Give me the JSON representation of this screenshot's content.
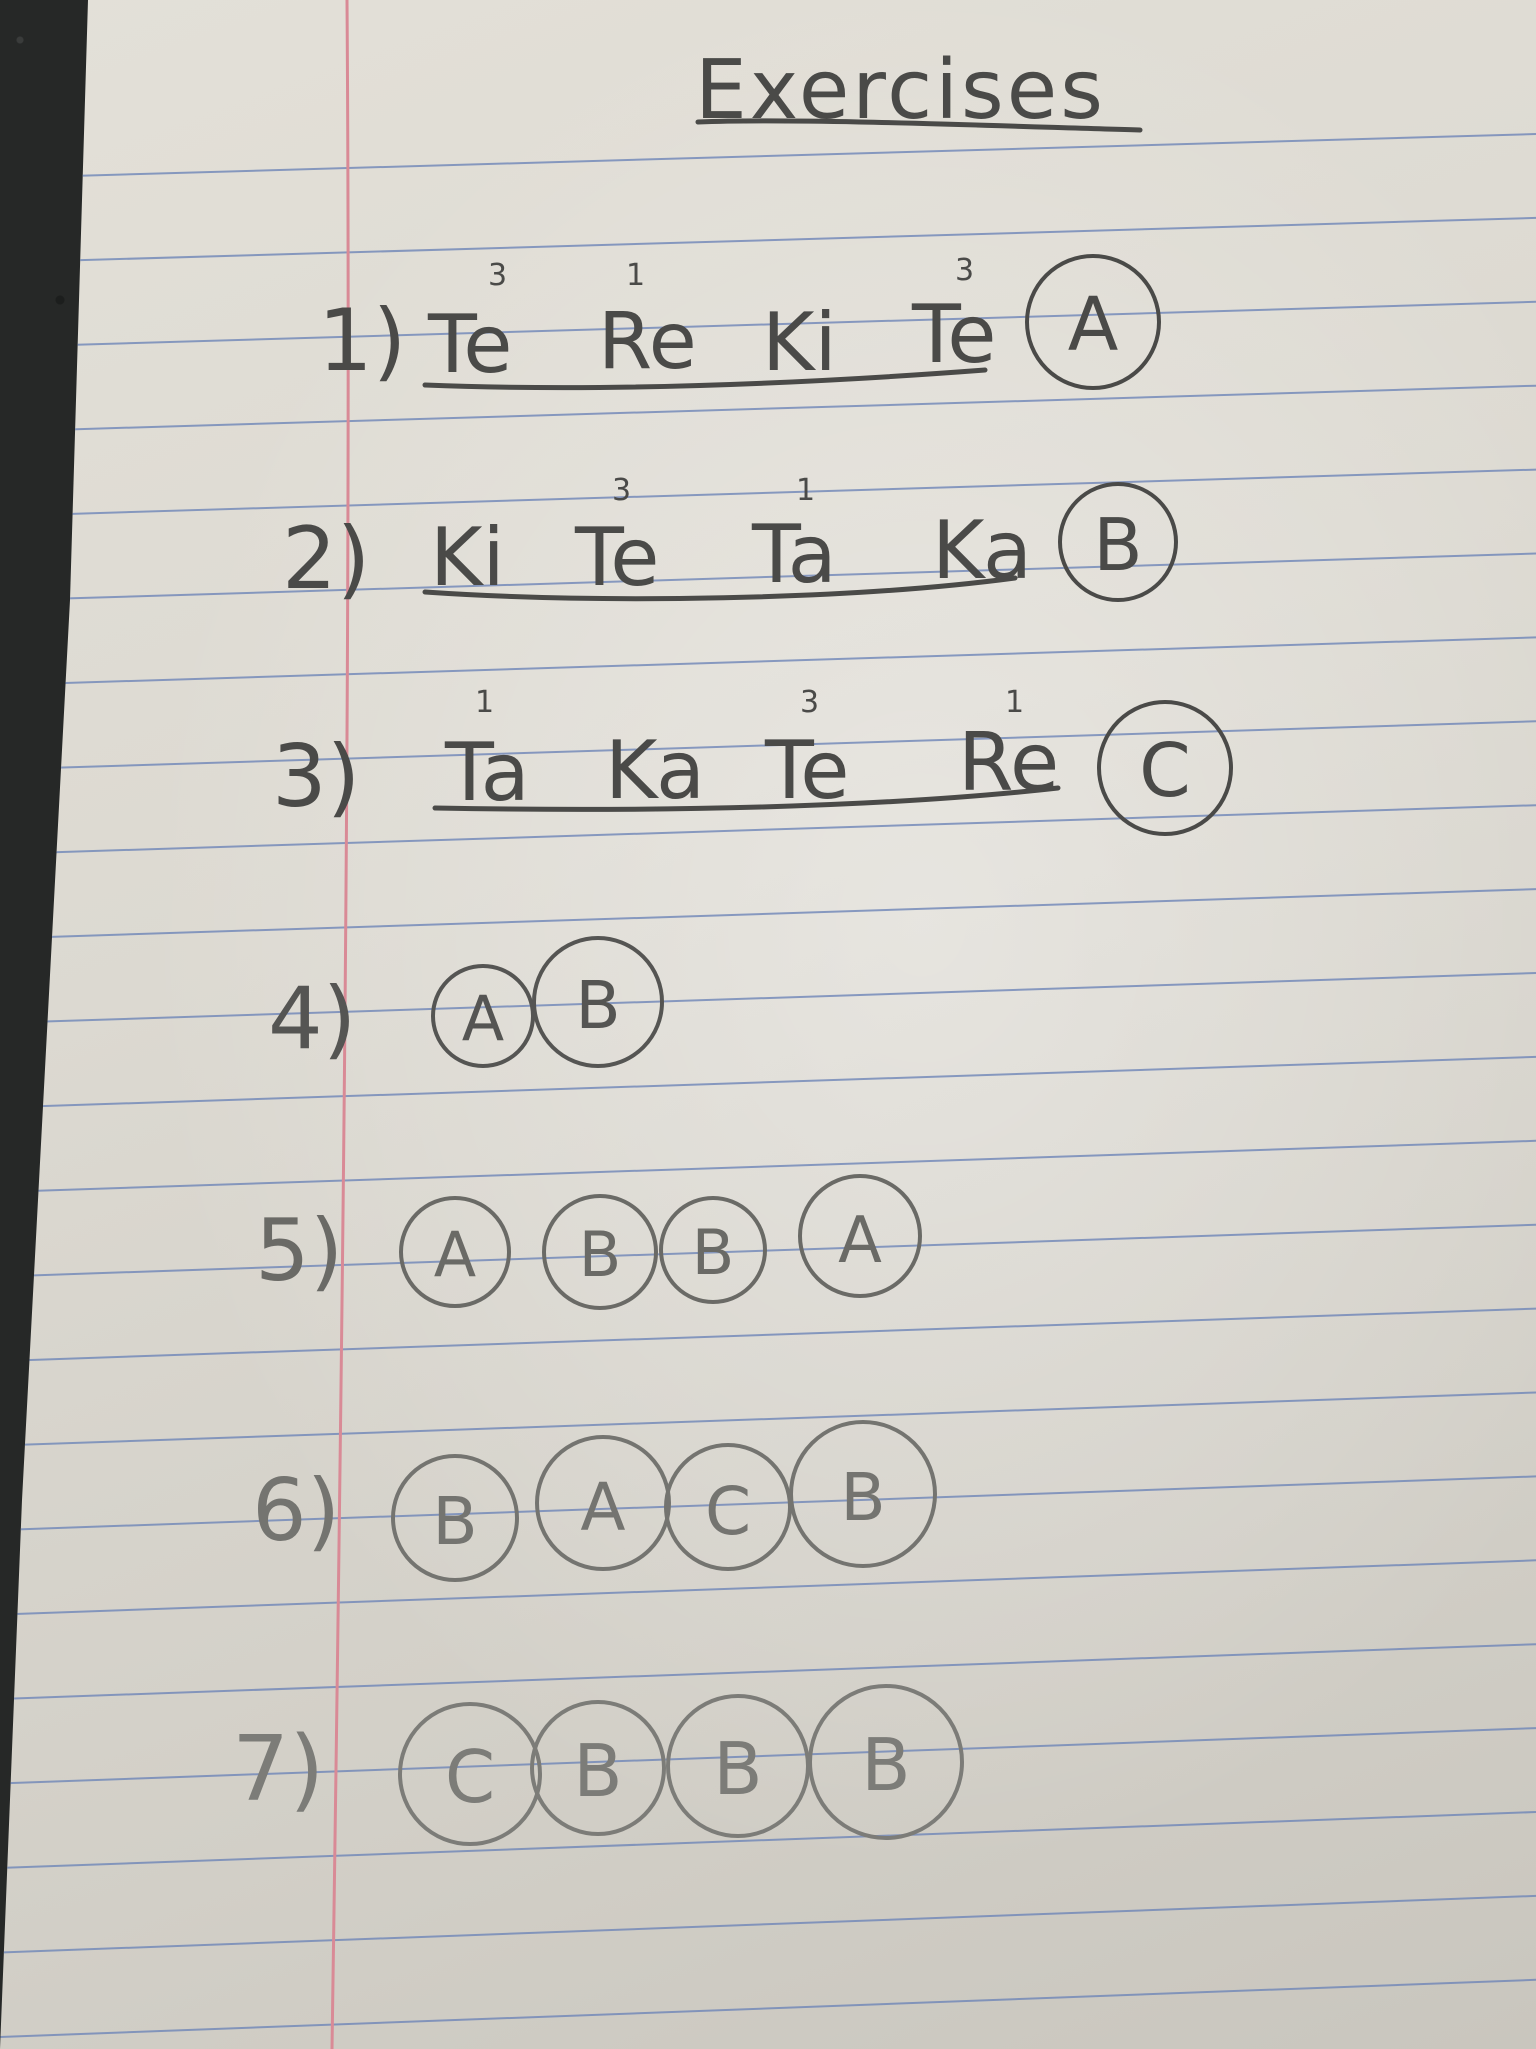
{
  "page": {
    "title": "Exercises",
    "colors": {
      "paper": "#dcd9d1",
      "rule_line": "#6f86b8",
      "margin_line": "#d98a96",
      "pencil": "#4a4a48",
      "pencil_light": "#7c7c78"
    }
  },
  "exercises": [
    {
      "number": "1)",
      "syllables": [
        {
          "text": "Te",
          "mark": "3"
        },
        {
          "text": "Re",
          "mark": "1"
        },
        {
          "text": "Ki",
          "mark": ""
        },
        {
          "text": "Te",
          "mark": "3"
        }
      ],
      "label": "A"
    },
    {
      "number": "2)",
      "syllables": [
        {
          "text": "Ki",
          "mark": ""
        },
        {
          "text": "Te",
          "mark": "3"
        },
        {
          "text": "Ta",
          "mark": "1"
        },
        {
          "text": "Ka",
          "mark": ""
        }
      ],
      "label": "B"
    },
    {
      "number": "3)",
      "syllables": [
        {
          "text": "Ta",
          "mark": "1"
        },
        {
          "text": "Ka",
          "mark": ""
        },
        {
          "text": "Te",
          "mark": "3"
        },
        {
          "text": "Re",
          "mark": "1"
        }
      ],
      "label": "C"
    },
    {
      "number": "4)",
      "circles": [
        "A",
        "B"
      ]
    },
    {
      "number": "5)",
      "circles": [
        "A",
        "B",
        "B",
        "A"
      ]
    },
    {
      "number": "6)",
      "circles": [
        "B",
        "A",
        "C",
        "B"
      ]
    },
    {
      "number": "7)",
      "circles": [
        "C",
        "B",
        "B",
        "B"
      ]
    }
  ]
}
